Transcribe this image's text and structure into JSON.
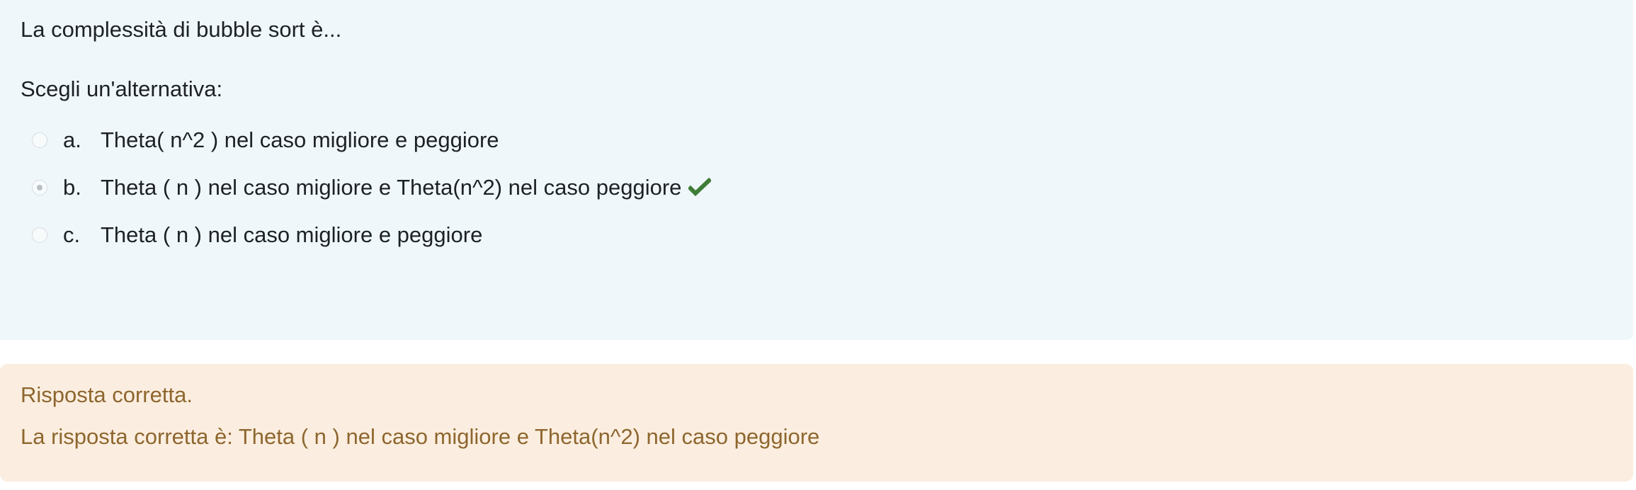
{
  "question": {
    "text": "La complessità di bubble sort è...",
    "prompt": "Scegli un'alternativa:",
    "options": [
      {
        "number": "a.",
        "label": "Theta( n^2 ) nel caso migliore e peggiore",
        "selected": false
      },
      {
        "number": "b.",
        "label": "Theta ( n ) nel caso migliore e Theta(n^2) nel caso peggiore",
        "selected": true,
        "correct_icon": "check-icon"
      },
      {
        "number": "c.",
        "label": "Theta ( n ) nel caso migliore e peggiore",
        "selected": false
      }
    ]
  },
  "feedback": {
    "result": "Risposta corretta.",
    "right_answer": "La risposta corretta è: Theta ( n ) nel caso migliore e Theta(n^2) nel caso peggiore"
  },
  "colors": {
    "question_background": "#eff7fa",
    "feedback_background": "#fbeee0",
    "feedback_text": "#8e662e",
    "correct_icon": "#3f7d37"
  }
}
